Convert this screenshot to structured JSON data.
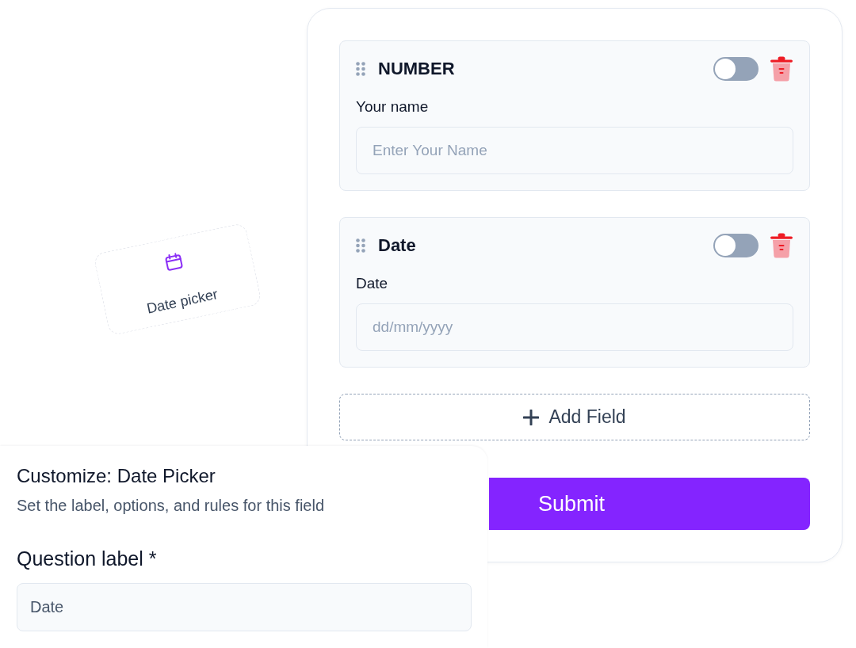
{
  "form": {
    "fields": [
      {
        "title": "NUMBER",
        "on": false,
        "label": "Your name",
        "placeholder": "Enter Your Name"
      },
      {
        "title": "Date",
        "on": false,
        "label": "Date",
        "placeholder": "dd/mm/yyyy"
      }
    ],
    "add_field_button": "Add Field",
    "submit_button": "Submit"
  },
  "dragged_tile": {
    "label": "Date picker"
  },
  "customize_panel": {
    "title": "Customize: Date Picker",
    "subtitle": "Set the label, options, and rules for this field",
    "question_label": "Question label *",
    "question_value": "Date"
  }
}
